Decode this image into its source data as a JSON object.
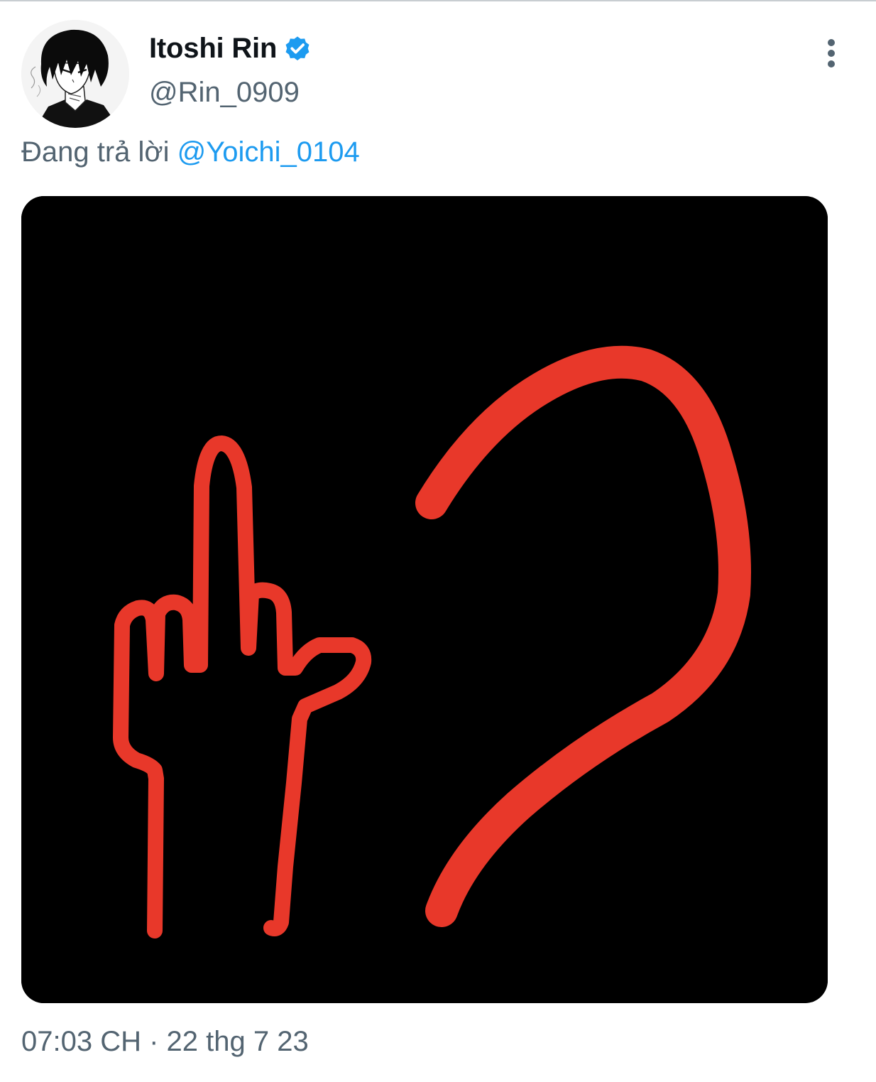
{
  "tweet": {
    "author": {
      "display_name": "Itoshi Rin",
      "handle": "@Rin_0909",
      "verified": true,
      "verified_icon": "verified-badge-icon",
      "avatar_icon": "anime-character-avatar"
    },
    "reply_context": {
      "prefix": "Đang trả lời ",
      "mention": "@Yoichi_0104"
    },
    "media": {
      "kind": "drawing",
      "background_color": "#000000",
      "stroke_color": "#e8382a"
    },
    "timestamp": "07:03 CH · 22 thg 7 23",
    "more_icon": "vertical-ellipsis-icon"
  },
  "colors": {
    "accent": "#1d9bf0",
    "text_primary": "#0f1419",
    "text_secondary": "#536471"
  }
}
